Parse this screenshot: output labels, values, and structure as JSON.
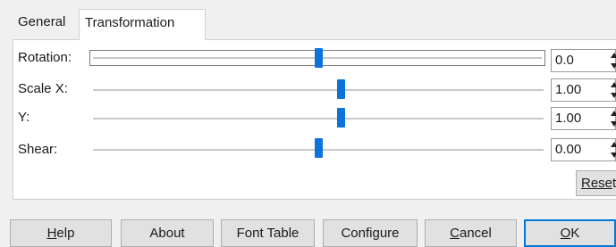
{
  "tabs": [
    {
      "label": "General",
      "active": false
    },
    {
      "label": "Transformation",
      "active": true
    }
  ],
  "rows": {
    "rotation": {
      "label": "Rotation:",
      "value": "0.0",
      "slider_fraction": 0.5
    },
    "scale_x": {
      "label": "Scale X:",
      "value": "1.00",
      "slider_fraction": 0.55
    },
    "scale_y": {
      "label": "Y:",
      "value": "1.00",
      "slider_fraction": 0.55
    },
    "shear": {
      "label": "Shear:",
      "value": "0.00",
      "slider_fraction": 0.5
    }
  },
  "reset": {
    "mnemonic_part": "Rese",
    "rest": "t"
  },
  "buttons": {
    "help": {
      "mnemonic": "H",
      "rest": "elp"
    },
    "about": "About",
    "font_table": "Font Table",
    "configure": "Configure",
    "cancel": {
      "mnemonic": "C",
      "rest": "ancel"
    },
    "ok": {
      "mnemonic": "O",
      "rest": "K"
    }
  },
  "colors": {
    "slider_thumb": "#0a74da",
    "default_button_border": "#0078d7"
  }
}
